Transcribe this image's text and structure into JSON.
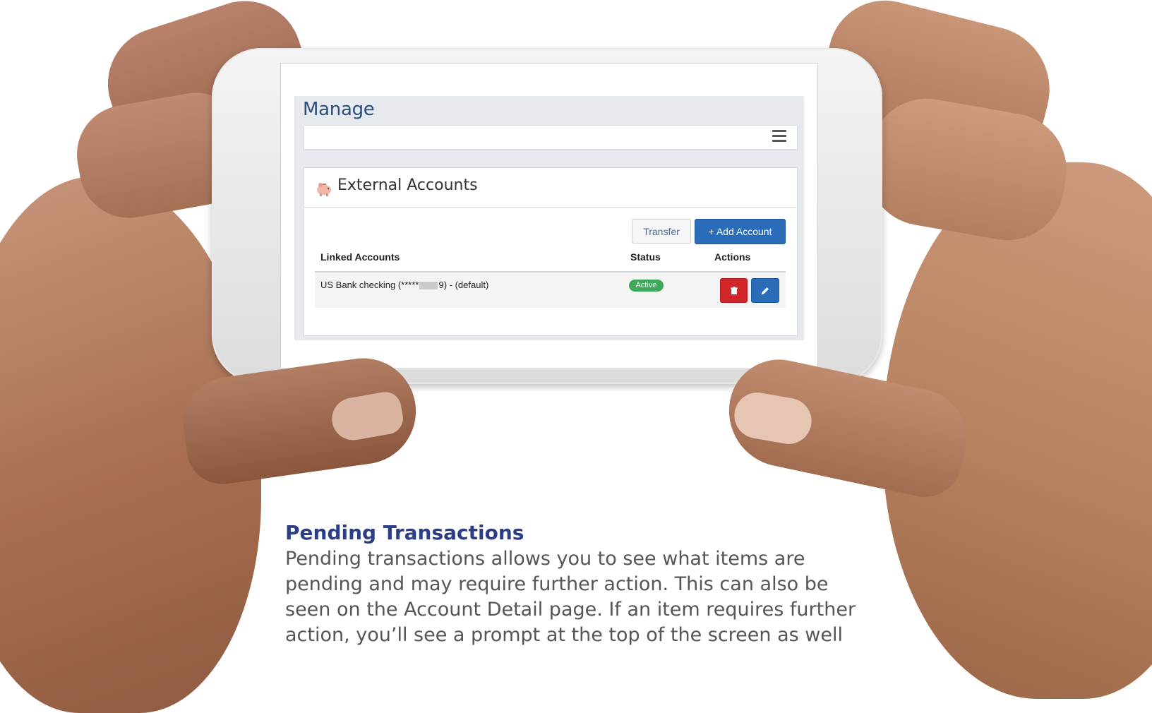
{
  "app": {
    "manage_title": "Manage"
  },
  "card": {
    "title": "External Accounts",
    "transfer_label": "Transfer",
    "add_account_label": "+ Add Account"
  },
  "table": {
    "headers": [
      "Linked Accounts",
      "Status",
      "Actions"
    ],
    "rows": [
      {
        "account_prefix": "US Bank checking (*****",
        "account_suffix": "9) - (default)",
        "status": "Active"
      }
    ]
  },
  "article": {
    "heading": "Pending Transactions",
    "lines": [
      "Pending transactions allows you to see what items are",
      "pending and may require further action. This can also be",
      "seen on the Account Detail page. If an item requires further",
      "action, you’ll see a prompt at the top of the screen as well"
    ]
  },
  "colors": {
    "primary": "#2b6cb8",
    "danger": "#d0262a",
    "success": "#3ea75a",
    "heading": "#2c3f86"
  },
  "icons": [
    "menu-icon",
    "piggy-bank-icon",
    "plus-icon",
    "trash-icon",
    "pencil-icon"
  ]
}
